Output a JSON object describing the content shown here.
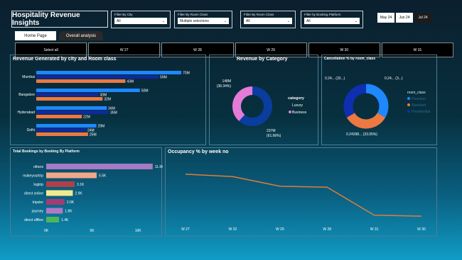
{
  "app": {
    "title": "Hospitality Revenue Insights"
  },
  "filters": [
    {
      "label": "Filter By City",
      "value": "All"
    },
    {
      "label": "Filter By Room Class",
      "value": "Multiple selections"
    },
    {
      "label": "Filter By Room Class",
      "value": "All"
    },
    {
      "label": "Filter by Booking Platform",
      "value": "All"
    }
  ],
  "months": [
    "May 24",
    "Jun 24",
    "Jul 24"
  ],
  "active_month": "Jul 24",
  "tabs": {
    "home": "Home Page",
    "overall": "Overall analysis"
  },
  "weeks": [
    "Select all",
    "W 27",
    "W 28",
    "W 29",
    "W 30",
    "W 31"
  ],
  "colors": {
    "blue": "#1e88ff",
    "orange": "#ec7842",
    "navy": "#0d2a9e",
    "pink": "#e47bd6",
    "dark_blue": "#0a3d9e",
    "line": "#e07d3a"
  },
  "charts": {
    "revenue_city": {
      "title": "Revenue Generated by city and Room class",
      "type": "bar",
      "categories": [
        "Mumbai",
        "Bangalore",
        "Hyderabad",
        "Delhi"
      ],
      "series": [
        {
          "values": [
            70,
            50,
            34,
            29
          ],
          "labels": [
            "70M",
            "50M",
            "34M",
            "29M"
          ]
        },
        {
          "values": [
            59,
            30,
            35,
            24
          ],
          "labels": [
            "59M",
            "30M",
            "35M",
            "24M"
          ]
        },
        {
          "values": [
            43,
            32,
            22,
            25
          ],
          "labels": [
            "43M",
            "32M",
            "22M",
            "25M"
          ]
        }
      ]
    },
    "revenue_category": {
      "title": "Revenue by Category",
      "type": "pie",
      "legend_title": "category",
      "legend": [
        "Luxury",
        "Business"
      ],
      "slices": [
        {
          "name": "Luxury",
          "value": 61.66,
          "label": "237M",
          "pct": "(61.66%)"
        },
        {
          "name": "Business",
          "value": 38.34,
          "label": "148M",
          "pct": "(38.34%)"
        }
      ]
    },
    "cancellation": {
      "title": "Cancellation % by room_class",
      "type": "pie",
      "legend_title": "room_class",
      "legend": [
        "Premium",
        "Standard",
        "Presidential"
      ],
      "labels": [
        "0.24... (32...)",
        "0.24... (3...)",
        "0.24298... (33.05%)"
      ],
      "slices": [
        {
          "name": "Premium",
          "value": 33.5
        },
        {
          "name": "Standard",
          "value": 33.05
        },
        {
          "name": "Presidential",
          "value": 33.45
        }
      ]
    },
    "bookings": {
      "title": "Total Bookings by Booking By Platform",
      "type": "bar",
      "categories": [
        "others",
        "makeyourtrip",
        "logtrip",
        "direct online",
        "tripster",
        "journey",
        "direct offline"
      ],
      "values": [
        11.6,
        5.5,
        3.1,
        2.9,
        2.0,
        1.8,
        1.4
      ],
      "labels": [
        "11.6K",
        "5.5K",
        "3.1K",
        "2.9K",
        "2.0K",
        "1.8K",
        "1.4K"
      ],
      "colors": [
        "#a47bc4",
        "#f3a68a",
        "#b04048",
        "#f2ea90",
        "#a63a72",
        "#b27ac6",
        "#4cb55b"
      ],
      "xticks": [
        "0K",
        "5K",
        "10K"
      ],
      "xlim": [
        0,
        12
      ]
    },
    "occupancy": {
      "title": "Occupancy % by week no",
      "type": "line",
      "x": [
        "W 27",
        "W 32",
        "W 29",
        "W 28",
        "W 31",
        "W 30"
      ],
      "values": [
        60,
        59.5,
        57.5,
        57.3,
        51.5,
        51.3
      ]
    }
  }
}
